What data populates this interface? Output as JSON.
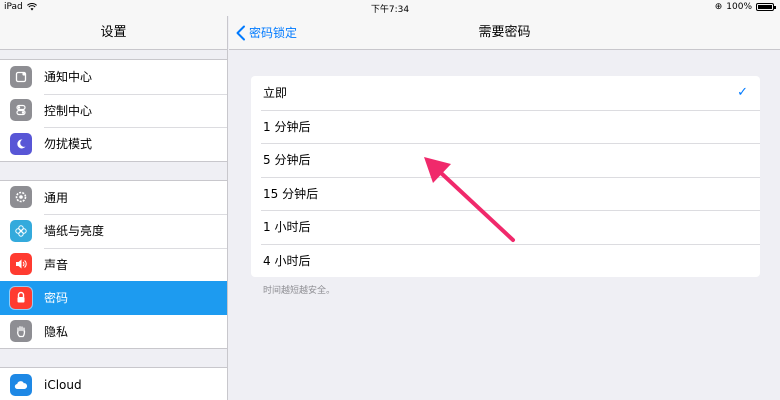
{
  "status_bar": {
    "device": "iPad",
    "time": "下午7:34",
    "battery": "100%"
  },
  "left_panel": {
    "title": "设置",
    "groups": [
      [
        {
          "label": "通知中心"
        },
        {
          "label": "控制中心"
        },
        {
          "label": "勿扰模式"
        }
      ],
      [
        {
          "label": "通用"
        },
        {
          "label": "墙纸与亮度"
        },
        {
          "label": "声音"
        },
        {
          "label": "密码"
        },
        {
          "label": "隐私"
        }
      ],
      [
        {
          "label": "iCloud"
        }
      ]
    ],
    "selected": "密码"
  },
  "right_panel": {
    "back_label": "密码锁定",
    "title": "需要密码",
    "options": [
      {
        "label": "立即",
        "checked": true
      },
      {
        "label": "1 分钟后"
      },
      {
        "label": "5 分钟后"
      },
      {
        "label": "15 分钟后"
      },
      {
        "label": "1 小时后"
      },
      {
        "label": "4 小时后"
      }
    ],
    "footer": "时间越短越安全。"
  },
  "colors": {
    "accent": "#007aff",
    "selected_row": "#1d9bf0",
    "annotation_arrow": "#f0296b"
  }
}
